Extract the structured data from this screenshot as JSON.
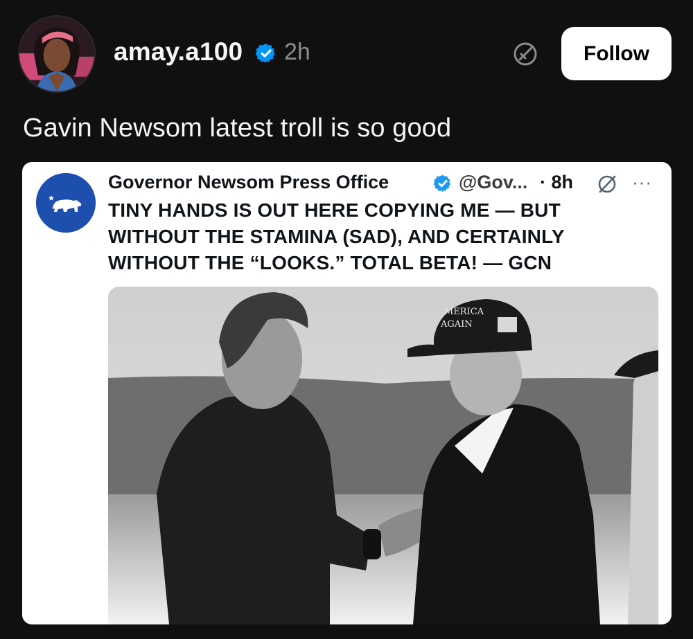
{
  "post": {
    "username": "amay.a100",
    "timestamp": "2h",
    "follow_label": "Follow",
    "caption": "Gavin Newsom latest troll is so good"
  },
  "icons": {
    "verified": "verified-badge-icon",
    "thread": "thread-quote-icon",
    "grok": "grok-icon",
    "more": "more-options-icon",
    "bear": "california-bear-icon"
  },
  "embedded_post": {
    "display_name": "Governor Newsom Press Office",
    "handle": "@Gov...",
    "time": "· 8h",
    "more": "···",
    "text": "TINY HANDS IS OUT HERE COPYING ME — BUT WITHOUT THE STAMINA (SAD), AND CERTAINLY WITHOUT THE “LOOKS.” TOTAL BETA! — GCN",
    "photo": {
      "hat_text_line1": "MERICA",
      "hat_text_line2": "AGAIN"
    }
  },
  "colors": {
    "background": "#101010",
    "verified_blue": "#0095f6",
    "card_avatar_blue": "#1d4fae",
    "follow_bg": "#ffffff"
  }
}
